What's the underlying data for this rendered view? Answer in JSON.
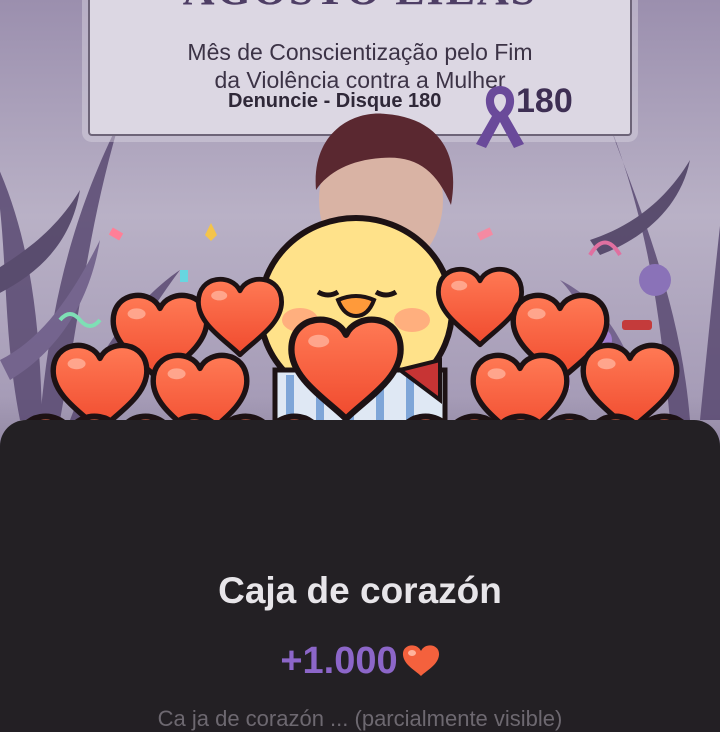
{
  "poster": {
    "title": "AGOSTO LILÁS",
    "subtitle_line1": "Mês de Conscientização pelo Fim",
    "subtitle_line2": "da Violência contra a Mulher",
    "call_to_action": "Denuncie - Disque 180",
    "number": "180"
  },
  "gift": {
    "name": "Caja de corazón",
    "reward": "+1.000",
    "reward_icon": "heart-icon",
    "description": "Ca ja de corazón ... (parcialmente visible)"
  },
  "colors": {
    "accent_purple": "#8c66c9",
    "sheet_bg": "#232024",
    "heart": "#f4613d"
  }
}
